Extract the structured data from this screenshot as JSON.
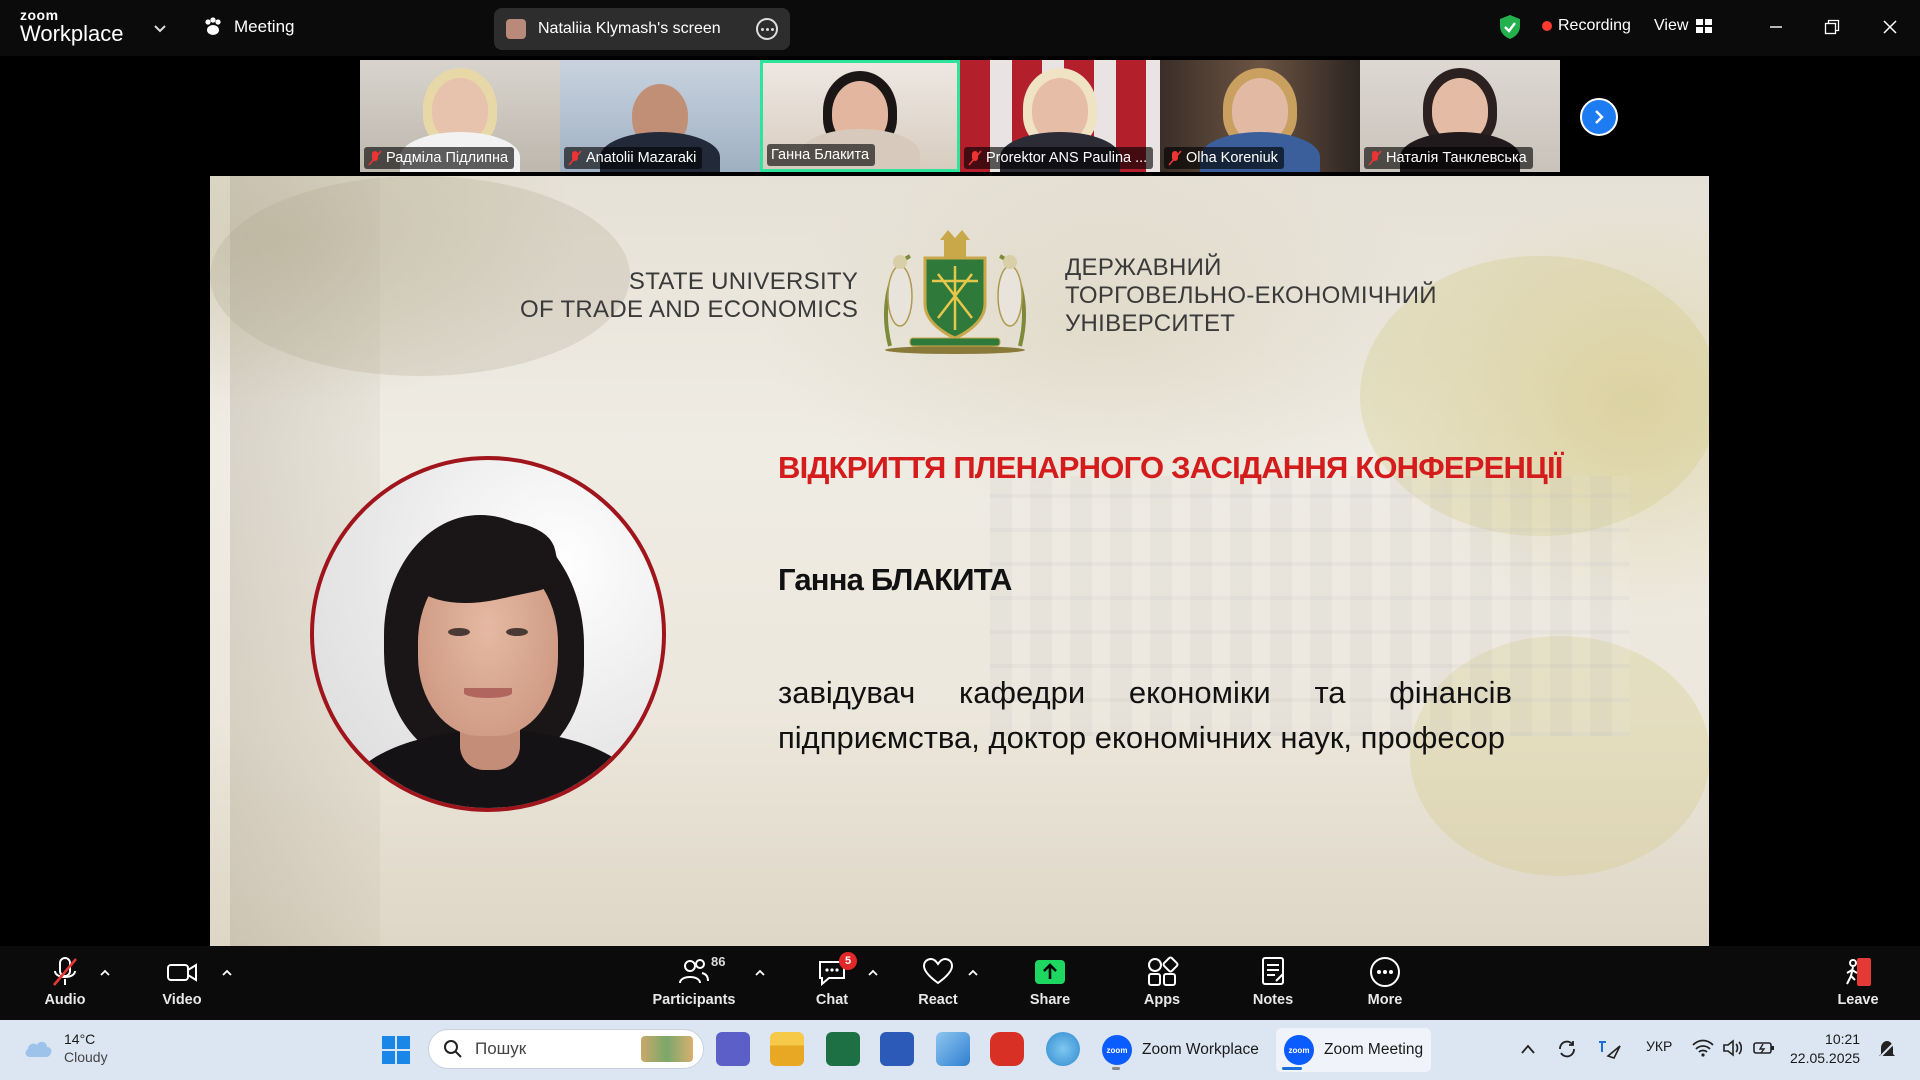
{
  "app": {
    "brand_small": "zoom",
    "brand_big": "Workplace",
    "meeting_label": "Meeting",
    "screen_share_label": "Nataliia Klymash's screen",
    "recording_label": "Recording",
    "view_label": "View"
  },
  "participants": [
    {
      "name": "Радміла Підлипна",
      "muted": true,
      "active": false
    },
    {
      "name": "Anatolii Mazaraki",
      "muted": true,
      "active": false
    },
    {
      "name": "Ганна Блакита",
      "muted": false,
      "active": true
    },
    {
      "name": "Prorektor ANS Paulina ...",
      "muted": true,
      "active": false
    },
    {
      "name": "Olha Koreniuk",
      "muted": true,
      "active": false
    },
    {
      "name": "Наталія Танклевська",
      "muted": true,
      "active": false
    }
  ],
  "slide": {
    "university_en_line1": "STATE UNIVERSITY",
    "university_en_line2": "OF TRADE AND ECONOMICS",
    "university_ua_line1": "ДЕРЖАВНИЙ",
    "university_ua_line2": "ТОРГОВЕЛЬНО-ЕКОНОМІЧНИЙ",
    "university_ua_line3": "УНІВЕРСИТЕТ",
    "title": "ВІДКРИТТЯ ПЛЕНАРНОГО ЗАСІДАННЯ КОНФЕРЕНЦІЇ",
    "speaker_name": "Ганна БЛАКИТА",
    "speaker_role": "завідувач кафедри економіки та фінансів підприємства, доктор економічних наук, професор",
    "colors": {
      "title": "#d41c1c",
      "portrait_border": "#a0141c"
    }
  },
  "toolbar": {
    "audio": "Audio",
    "video": "Video",
    "participants": "Participants",
    "participants_count": "86",
    "chat": "Chat",
    "chat_badge": "5",
    "react": "React",
    "share": "Share",
    "apps": "Apps",
    "notes": "Notes",
    "more": "More",
    "leave": "Leave"
  },
  "taskbar": {
    "temperature": "14°C",
    "weather": "Cloudy",
    "search_placeholder": "Пошук",
    "zoom_workplace": "Zoom Workplace",
    "zoom_meeting": "Zoom Meeting",
    "language": "УКР",
    "time": "10:21",
    "date": "22.05.2025"
  },
  "icons": [
    "cloud-icon",
    "windows-start-icon",
    "search-icon",
    "teams-icon",
    "file-explorer-icon",
    "excel-icon",
    "word-icon",
    "remote-desktop-icon",
    "acrobat-icon",
    "zoom-icon",
    "wifi-icon",
    "volume-icon",
    "battery-icon",
    "notification-icon",
    "shield-icon",
    "mic-muted-icon",
    "camera-icon",
    "participants-icon",
    "chat-icon",
    "heart-icon",
    "share-arrow-icon",
    "apps-icon",
    "notes-icon",
    "more-icon",
    "leave-icon"
  ],
  "accent_colors": {
    "zoom_blue": "#0b5cff",
    "share_green": "#1ed760",
    "active_frame": "#2ee39a",
    "record_red": "#ff3b30"
  }
}
